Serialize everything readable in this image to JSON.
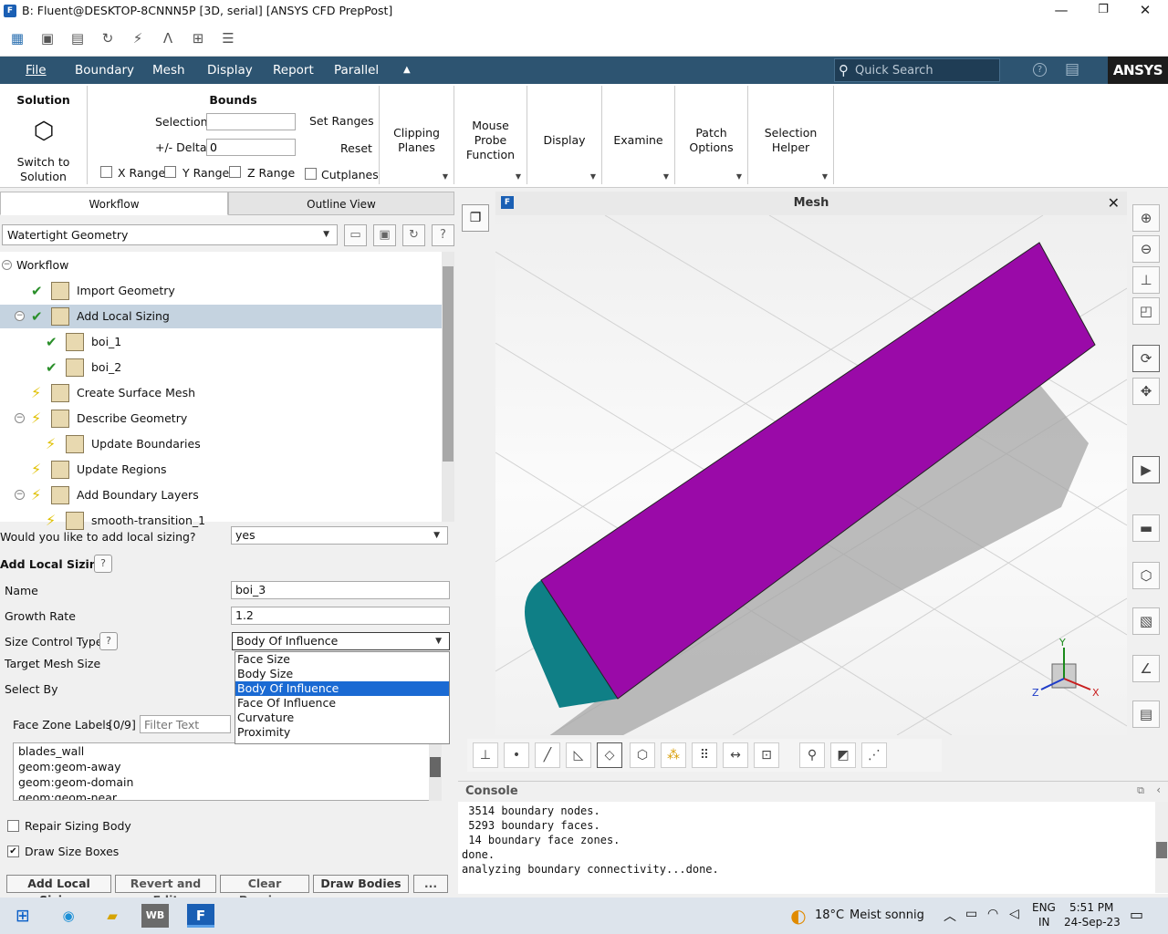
{
  "window": {
    "title": "B: Fluent@DESKTOP-8CNNN5P  [3D, serial] [ANSYS CFD PrepPost]",
    "app_icon": "F",
    "minimize": "—",
    "maximize": "❐",
    "close": "✕"
  },
  "menubar": {
    "items": [
      "File",
      "Boundary",
      "Mesh",
      "Display",
      "Report",
      "Parallel"
    ],
    "collapse": "▲",
    "search_placeholder": "Quick Search",
    "help": "?",
    "brand": "ANSYS"
  },
  "ribbon": {
    "solution": {
      "title": "Solution",
      "button": "Switch to\nSolution"
    },
    "bounds": {
      "title": "Bounds",
      "selection_label": "Selection",
      "selection_value": "",
      "delta_label": "+/- Delta",
      "delta_value": "0",
      "set_ranges": "Set Ranges",
      "reset": "Reset",
      "x_range": "X Range",
      "y_range": "Y Range",
      "z_range": "Z Range",
      "cutplanes": "Cutplanes"
    },
    "groups": [
      "Clipping\nPlanes",
      "Mouse\nProbe\nFunction",
      "Display",
      "Examine",
      "Patch\nOptions",
      "Selection\nHelper"
    ]
  },
  "left": {
    "tabs": [
      "Workflow",
      "Outline View"
    ],
    "workflow_type": "Watertight Geometry",
    "tree": [
      {
        "label": "Workflow",
        "indent": 0,
        "state": "root"
      },
      {
        "label": "Import Geometry",
        "indent": 1,
        "state": "done"
      },
      {
        "label": "Add Local Sizing",
        "indent": 1,
        "state": "done",
        "selected": true
      },
      {
        "label": "boi_1",
        "indent": 2,
        "state": "done"
      },
      {
        "label": "boi_2",
        "indent": 2,
        "state": "done"
      },
      {
        "label": "Create Surface Mesh",
        "indent": 1,
        "state": "pending"
      },
      {
        "label": "Describe Geometry",
        "indent": 1,
        "state": "pending"
      },
      {
        "label": "Update Boundaries",
        "indent": 2,
        "state": "pending"
      },
      {
        "label": "Update Regions",
        "indent": 1,
        "state": "pending"
      },
      {
        "label": "Add Boundary Layers",
        "indent": 1,
        "state": "pending"
      },
      {
        "label": "smooth-transition_1",
        "indent": 2,
        "state": "pending"
      }
    ],
    "question": "Would you like to add local sizing?",
    "question_value": "yes",
    "section": "Add Local Sizing",
    "name_label": "Name",
    "name_value": "boi_3",
    "growth_label": "Growth Rate",
    "growth_value": "1.2",
    "size_type_label": "Size Control Type",
    "size_type_value": "Body Of Influence",
    "target_label": "Target Mesh Size",
    "select_by_label": "Select By",
    "dropdown_options": [
      "Face Size",
      "Body Size",
      "Body Of Influence",
      "Face Of Influence",
      "Curvature",
      "Proximity"
    ],
    "dropdown_selected": 2,
    "face_zone_label": "Face Zone Labels",
    "face_zone_count": "[0/9]",
    "filter_placeholder": "Filter Text",
    "face_zones": [
      "blades_wall",
      "geom:geom-away",
      "geom:geom-domain",
      "geom:geom-near"
    ],
    "repair_label": "Repair Sizing Body",
    "draw_label": "Draw Size Boxes",
    "buttons": [
      "Add Local Sizing",
      "Revert and Edit",
      "Clear Preview",
      "Draw Bodies",
      "..."
    ]
  },
  "viewport": {
    "title": "Mesh",
    "close": "✕",
    "axes": {
      "x": "X",
      "y": "Y",
      "z": "Z"
    },
    "colors": {
      "body": "#9a0aa8",
      "end": "#0f7f86"
    }
  },
  "console": {
    "title": "Console",
    "lines": [
      " 3514 boundary nodes.",
      " 5293 boundary faces.",
      " 14 boundary face zones.",
      "done.",
      "analyzing boundary connectivity...done."
    ]
  },
  "taskbar": {
    "temp": "18°C",
    "weather": "Meist sonnig",
    "lang1": "ENG",
    "lang2": "IN",
    "time": "5:51 PM",
    "date": "24-Sep-23"
  }
}
